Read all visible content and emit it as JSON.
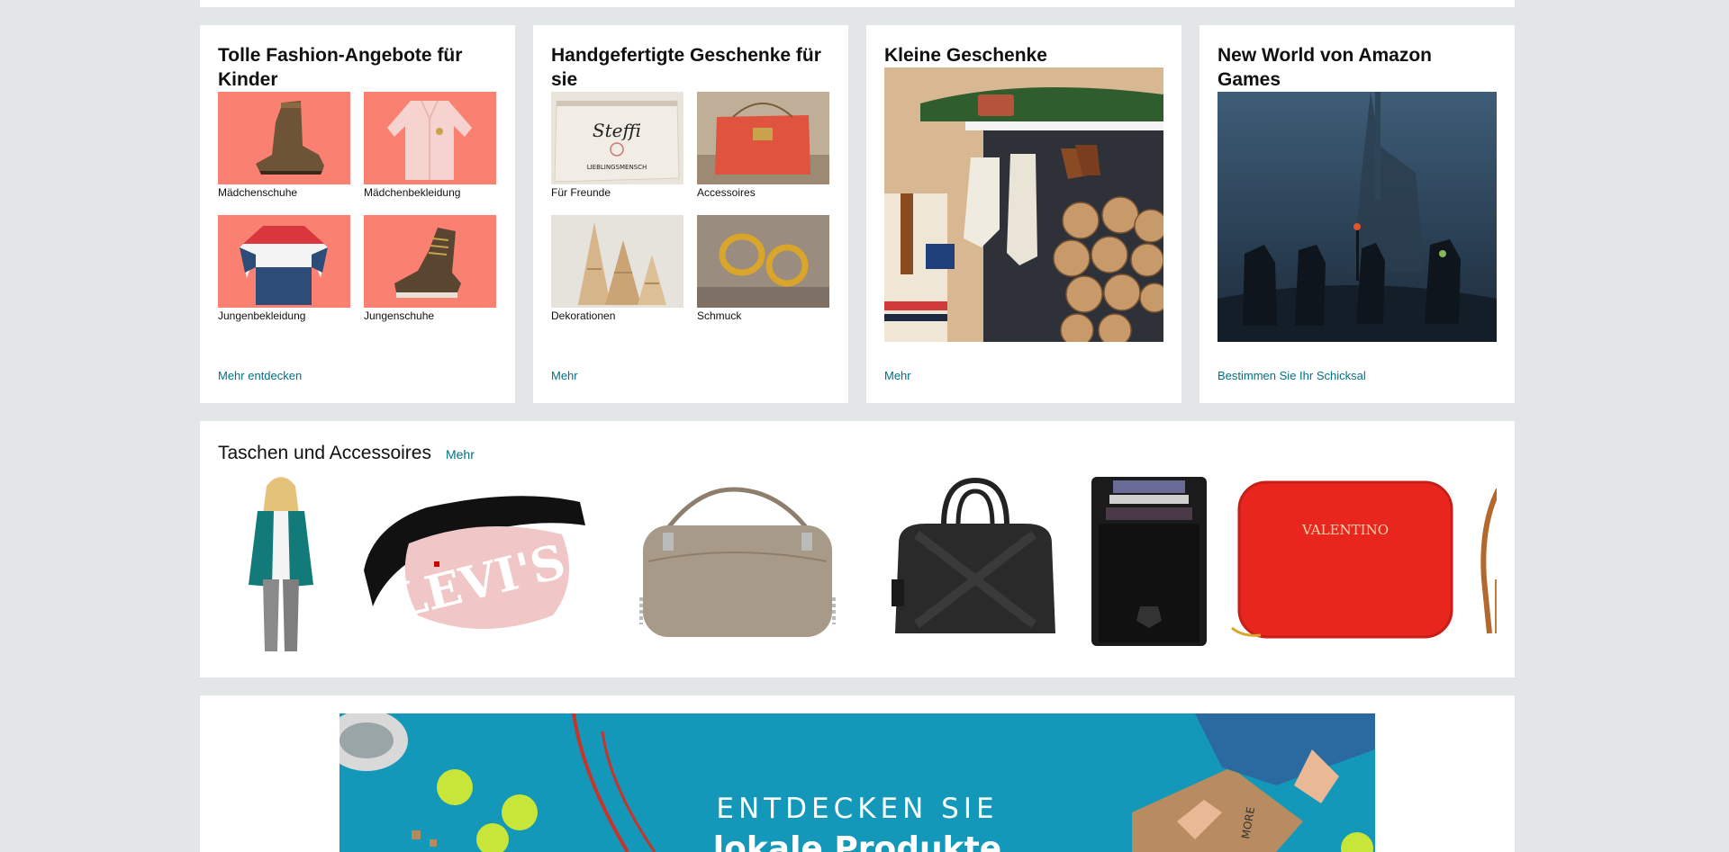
{
  "cards": [
    {
      "title": "Tolle Fashion-Angebote für Kinder",
      "tiles": [
        "Mädchenschuhe",
        "Mädchenbekleidung",
        "Jungenbekleidung",
        "Jungenschuhe"
      ],
      "link": "Mehr entdecken"
    },
    {
      "title": "Handgefertigte Geschenke für sie",
      "tiles": [
        "Für Freunde",
        "Accessoires",
        "Dekorationen",
        "Schmuck"
      ],
      "pouch_text": "Steffi",
      "pouch_subtext": "LIEBLINGSMENSCH",
      "link": "Mehr"
    },
    {
      "title": "Kleine Geschenke",
      "link": "Mehr"
    },
    {
      "title": "New World von Amazon Games",
      "link": "Bestimmen Sie Ihr Schicksal"
    }
  ],
  "strip": {
    "title": "Taschen und Accessoires",
    "more": "Mehr",
    "levis_text": "LEVI'S",
    "valentino_text": "VALENTINO"
  },
  "banner": {
    "line1": "ENTDECKEN SIE",
    "line2": "lokale Produkte",
    "box_text": "MORE"
  },
  "colors": {
    "link": "#007185",
    "salmon": "#fa8072",
    "background": "#e3e6e6",
    "banner": "#1398b9"
  }
}
